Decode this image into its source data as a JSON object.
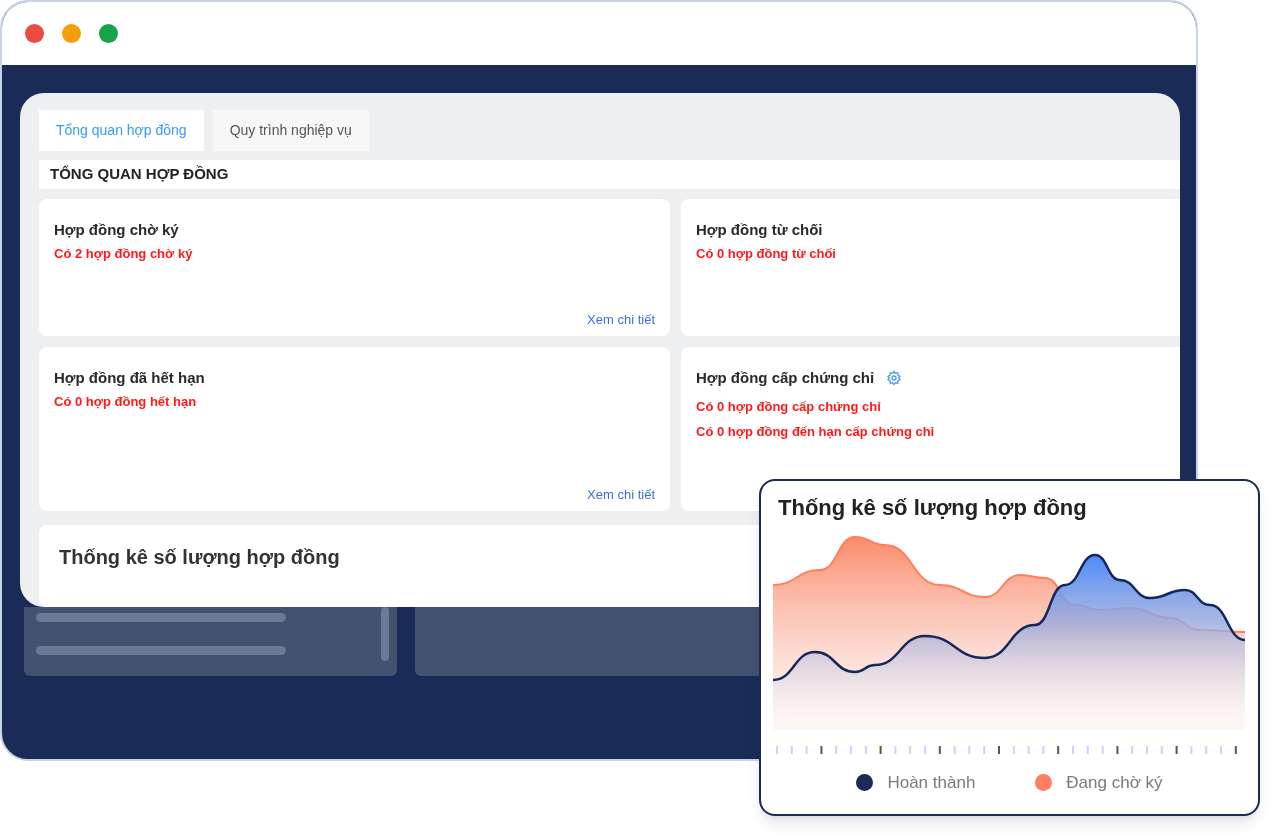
{
  "tabs": [
    {
      "label": "Tổng quan hợp đồng",
      "selected": true
    },
    {
      "label": "Quy trình nghiệp vụ",
      "selected": false
    }
  ],
  "section_title": "TỔNG QUAN HỢP ĐỒNG",
  "cards": [
    {
      "title": "Hợp đồng chờ ký",
      "settings": false,
      "lines": [
        "Có 2 hợp đồng chờ ký"
      ],
      "link": "Xem chi tiết"
    },
    {
      "title": "Hợp đồng từ chối",
      "settings": false,
      "lines": [
        "Có 0 hợp đồng từ chối"
      ]
    },
    {
      "title": "Hợp đồng đã hết hạn",
      "settings": false,
      "lines": [
        "Có 0 hợp đồng hết hạn"
      ],
      "link": "Xem chi tiết"
    },
    {
      "title": "Hợp đồng cấp chứng chỉ",
      "settings": true,
      "lines": [
        "Có 0 hợp đồng cấp chứng chỉ",
        "Có 0 hợp đồng đến hạn cấp chứng chỉ"
      ]
    }
  ],
  "stats_title": "Thống kê số lượng hợp đồng",
  "popup": {
    "title": "Thống kê số lượng hợp đồng",
    "legend": [
      {
        "label": "Hoàn thành",
        "color": "#1b2b57"
      },
      {
        "label": "Đang chờ ký",
        "color": "#ff8060"
      }
    ]
  }
}
